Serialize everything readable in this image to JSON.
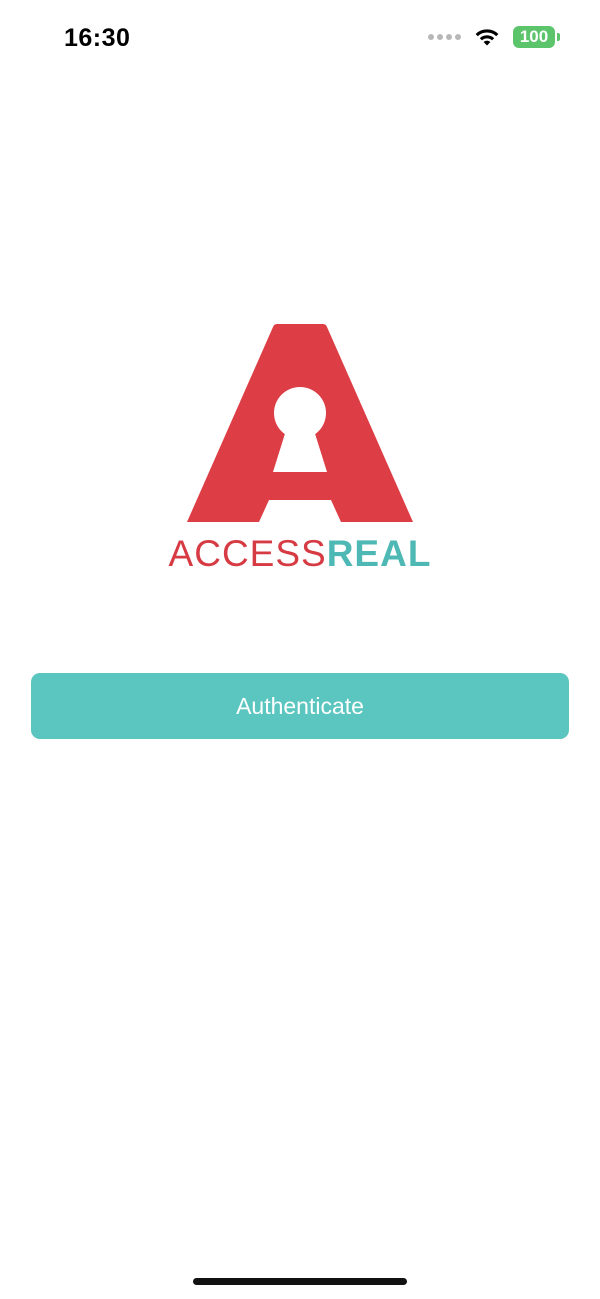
{
  "status_bar": {
    "time": "16:30",
    "battery_level": "100",
    "signal_icon": "cellular-signal-dots",
    "wifi_icon": "wifi-icon"
  },
  "logo": {
    "word_part_1": "ACCESS",
    "word_part_2": "REAL",
    "colors": {
      "red": "#d63b44",
      "teal": "#4db8b4"
    }
  },
  "auth": {
    "button_label": "Authenticate",
    "button_color": "#5bc6bf"
  }
}
